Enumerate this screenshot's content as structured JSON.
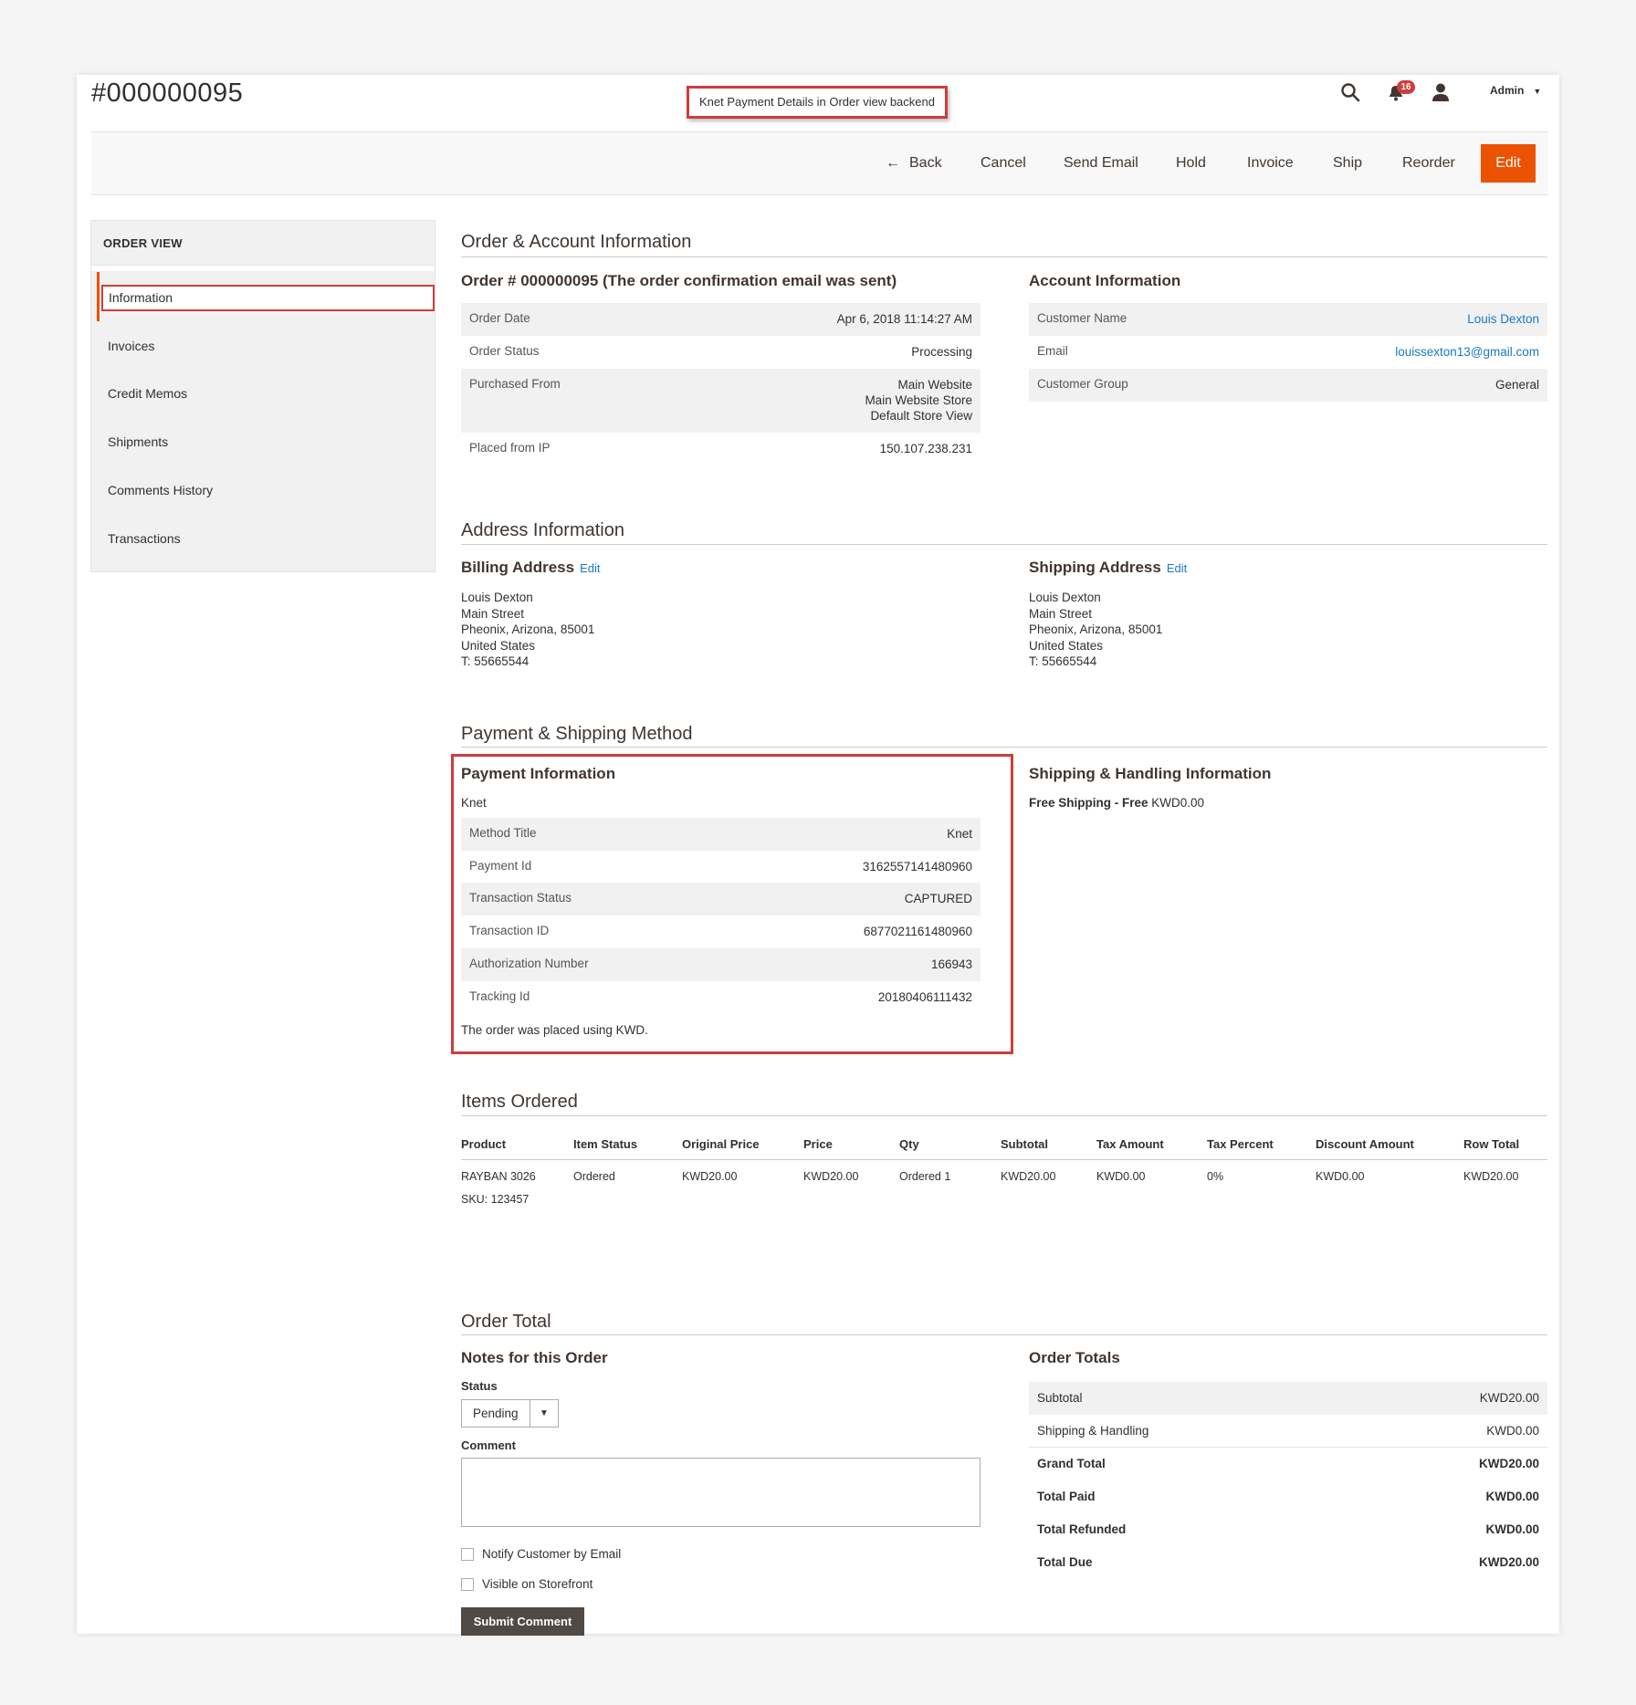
{
  "header": {
    "order_number": "#000000095",
    "callout": "Knet Payment Details in Order view backend",
    "notification_count": "16",
    "admin_label": "Admin"
  },
  "actions": {
    "back": "Back",
    "cancel": "Cancel",
    "send_email": "Send Email",
    "hold": "Hold",
    "invoice": "Invoice",
    "ship": "Ship",
    "reorder": "Reorder",
    "edit": "Edit"
  },
  "sidebar": {
    "title": "ORDER VIEW",
    "items": [
      "Information",
      "Invoices",
      "Credit Memos",
      "Shipments",
      "Comments History",
      "Transactions"
    ]
  },
  "order_account": {
    "section_title": "Order & Account Information",
    "order_title": "Order # 000000095 (The order confirmation email was sent)",
    "order_rows": [
      {
        "k": "Order Date",
        "v": "Apr 6, 2018 11:14:27 AM"
      },
      {
        "k": "Order Status",
        "v": "Processing"
      },
      {
        "k": "Purchased From",
        "v1": "Main Website",
        "v2": "Main Website Store",
        "v3": "Default Store View"
      },
      {
        "k": "Placed from IP",
        "v": "150.107.238.231"
      }
    ],
    "account_title": "Account Information",
    "account_rows": [
      {
        "k": "Customer Name",
        "v": "Louis Dexton"
      },
      {
        "k": "Email",
        "v": "louissexton13@gmail.com"
      },
      {
        "k": "Customer Group",
        "v": "General"
      }
    ]
  },
  "address": {
    "section_title": "Address Information",
    "edit_label": "Edit",
    "billing_title": "Billing Address",
    "billing_lines": [
      "Louis Dexton",
      "Main Street",
      "Pheonix, Arizona, 85001",
      "United States",
      "T: 55665544"
    ],
    "shipping_title": "Shipping Address",
    "shipping_lines": [
      "Louis Dexton",
      "Main Street",
      "Pheonix, Arizona, 85001",
      "United States",
      "T: 55665544"
    ]
  },
  "payment_shipping": {
    "section_title": "Payment & Shipping Method",
    "payment_title": "Payment Information",
    "method_name": "Knet",
    "rows": [
      {
        "k": "Method Title",
        "v": "Knet"
      },
      {
        "k": "Payment Id",
        "v": "3162557141480960"
      },
      {
        "k": "Transaction Status",
        "v": "CAPTURED"
      },
      {
        "k": "Transaction ID",
        "v": "6877021161480960"
      },
      {
        "k": "Authorization Number",
        "v": "166943"
      },
      {
        "k": "Tracking Id",
        "v": "20180406111432"
      }
    ],
    "currency_note": "The order was placed using KWD.",
    "shipping_title": "Shipping & Handling Information",
    "shipping_method": "Free Shipping - Free",
    "shipping_price": "KWD0.00"
  },
  "items": {
    "section_title": "Items Ordered",
    "columns": [
      "Product",
      "Item Status",
      "Original Price",
      "Price",
      "Qty",
      "Subtotal",
      "Tax Amount",
      "Tax Percent",
      "Discount Amount",
      "Row Total"
    ],
    "rows": [
      {
        "product": "RAYBAN 3026",
        "sku": "SKU: 123457",
        "status": "Ordered",
        "original_price": "KWD20.00",
        "price": "KWD20.00",
        "qty": "Ordered 1",
        "subtotal": "KWD20.00",
        "tax_amount": "KWD0.00",
        "tax_percent": "0%",
        "discount": "KWD0.00",
        "row_total": "KWD20.00"
      }
    ]
  },
  "order_total": {
    "section_title": "Order Total",
    "notes_title": "Notes for this Order",
    "status_label": "Status",
    "status_value": "Pending",
    "comment_label": "Comment",
    "notify_label": "Notify Customer by Email",
    "visible_label": "Visible on Storefront",
    "submit_label": "Submit Comment",
    "totals_title": "Order Totals",
    "totals": [
      {
        "k": "Subtotal",
        "v": "KWD20.00"
      },
      {
        "k": "Shipping & Handling",
        "v": "KWD0.00"
      },
      {
        "k": "Grand Total",
        "v": "KWD20.00"
      },
      {
        "k": "Total Paid",
        "v": "KWD0.00"
      },
      {
        "k": "Total Refunded",
        "v": "KWD0.00"
      },
      {
        "k": "Total Due",
        "v": "KWD20.00"
      }
    ]
  },
  "colors": {
    "accent": "#eb5202",
    "highlight": "#d13c3c",
    "link": "#1979c3",
    "dark_button": "#514943"
  }
}
